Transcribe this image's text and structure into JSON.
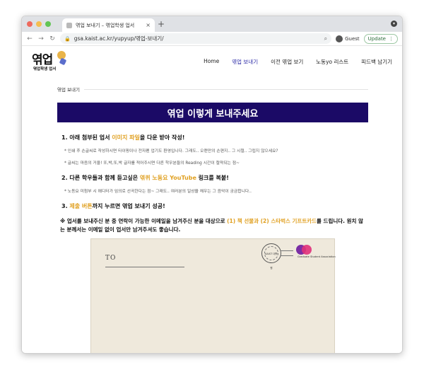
{
  "browser": {
    "tab_title": "엮업 보내기 – 엮업학생 업서",
    "tab_close": "×",
    "new_tab": "+",
    "tab_menu": "▾",
    "url": "gsa.kaist.ac.kr/yupyup/엮업-보내기/",
    "guest_label": "Guest",
    "update_label": "Update",
    "update_menu": "⋮",
    "back": "←",
    "forward": "→",
    "reload": "↻",
    "lock_icon": "🔒",
    "zoom_icon": "⌕",
    "traffic_colors": [
      "#ee6a5e",
      "#f5be4f",
      "#62c554"
    ]
  },
  "site": {
    "logo_main": "엮업",
    "logo_sub": "엮업학생 업서",
    "menu": [
      {
        "label": "Home",
        "active": false
      },
      {
        "label": "엮업 보내기",
        "active": true
      },
      {
        "label": "이전 엮업 보기",
        "active": false
      },
      {
        "label": "노동yo 리스트",
        "active": false
      },
      {
        "label": "피드백 남기기",
        "active": false
      }
    ]
  },
  "main": {
    "breadcrumb": "엮업 보내기",
    "banner_title": "엮업 이렇게 보내주세요",
    "banner_color": "#1b0a66",
    "highlight_color": "#e0a021",
    "step1": {
      "pre": "1. 아래 첨부된 업서 ",
      "hl": "이미지 파일",
      "post": "을 다운 받아 작성!"
    },
    "step1_note": "* 인쇄 후 손글씨로 작성하시면 타이핑이나 전자펜 업기도 환영입니다. 그래도.. 오랜만의 손편지.. 그 시절.. 그립지 않으세요?",
    "step1_note2": "* 글씨는 마음의 거울! 또,박,또,박 글자를 적어주시면 다른 학우분들의 Reading 시간이 절약되는 점~",
    "step2": {
      "pre": "2. 다른 학우들과 함께 듣고싶은 ",
      "hl": "엮퀴 노동요 YouTube",
      "post": " 링크를 복붙!"
    },
    "step2_note": "* 노동요 미첨부 시 에디터가 임의로 선곡한다는 점~ 그래도.. 여러분의 일상을 채우는 그 음악이 궁금합니다..",
    "step3": {
      "pre": "3. ",
      "hl": "제출 버튼",
      "post": "까지 누르면 엮업 보내기 성공!"
    },
    "notice": {
      "pre": "※ 업서를 보내주신 분 중 연락이 가능한 이메일을 남겨주신 분을 대상으로 ",
      "hl": "(1) 책 선물과 (2) 스타벅스 기프트카드",
      "post": "를 드립니다. 원치 않는 분께서는 이메일 없이 업서만 남겨주셔도 좋습니다."
    }
  },
  "postcard": {
    "to_label": "TO",
    "stamp_text": "KAIST 대학원",
    "org_name": "Graduate Student Association"
  }
}
